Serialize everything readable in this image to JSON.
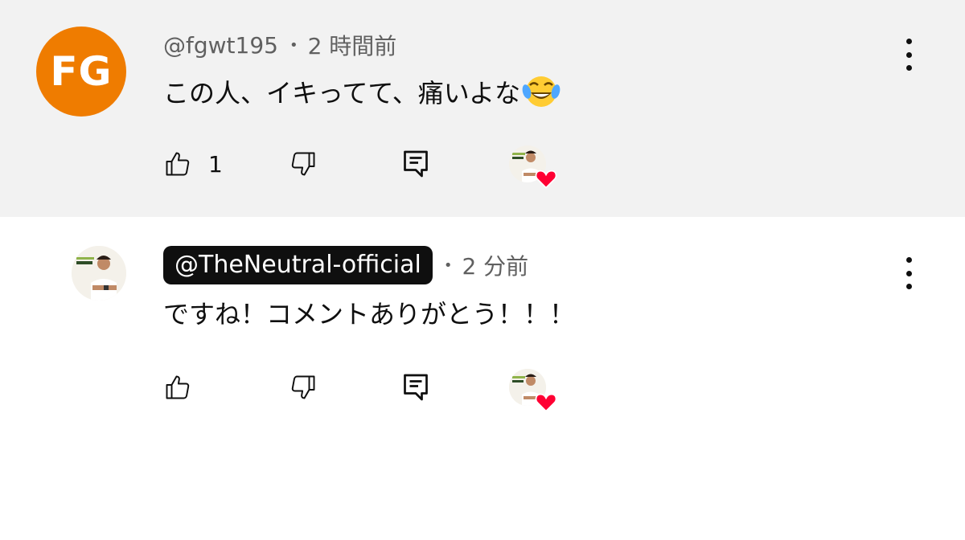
{
  "comments": [
    {
      "author": "@fgwt195",
      "separator": "•",
      "time": "2 時間前",
      "avatar_initials": "FG",
      "avatar_color": "#ef7c00",
      "text": "この人、イキってて、痛いよな",
      "emoji": "tears-of-joy-emoji",
      "like_count": "1",
      "hearted_by_creator": true
    },
    {
      "author": "@TheNeutral-official",
      "author_is_owner": true,
      "separator": "•",
      "time": "2 分前",
      "text": "ですね！コメントありがとう！！！",
      "like_count": "",
      "hearted_by_creator": true
    }
  ],
  "icons": {
    "like": "thumbs-up-icon",
    "dislike": "thumbs-down-icon",
    "reply": "reply-comment-icon",
    "more": "more-vertical-icon",
    "heart": "creator-heart-icon"
  },
  "colors": {
    "top_background": "#f2f2f2",
    "heart_red": "#ff0033",
    "owner_badge": "#0f0f0f"
  }
}
